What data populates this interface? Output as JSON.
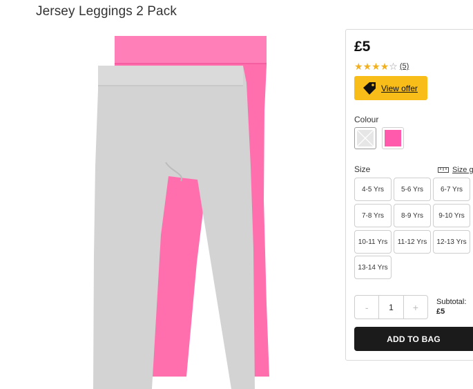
{
  "product": {
    "title": "Jersey Leggings 2 Pack",
    "price": "£5",
    "rating": {
      "value": 4,
      "max": 5,
      "count_label": "(5)"
    },
    "offer_label": "View offer"
  },
  "colour": {
    "label": "Colour",
    "options": [
      {
        "name": "grey",
        "color": "#e6e6e6",
        "selected": true
      },
      {
        "name": "pink",
        "color": "#ff5aac",
        "selected": false
      }
    ]
  },
  "size": {
    "label": "Size",
    "guide_label": "Size g",
    "options": [
      "4-5 Yrs",
      "5-6 Yrs",
      "6-7 Yrs",
      "7-8 Yrs",
      "8-9 Yrs",
      "9-10 Yrs",
      "10-11 Yrs",
      "11-12 Yrs",
      "12-13 Yrs",
      "13-14 Yrs"
    ]
  },
  "quantity": {
    "minus": "-",
    "value": "1",
    "plus": "+"
  },
  "subtotal": {
    "label": "Subtotal:",
    "amount": "£5"
  },
  "add_to_bag": "ADD TO BAG",
  "colors": {
    "offer_yellow": "#f8bd18",
    "star": "#f2b01e",
    "button_dark": "#1b1b1b",
    "legging_pink": "#ff6fae",
    "legging_grey": "#d2d2d2"
  }
}
